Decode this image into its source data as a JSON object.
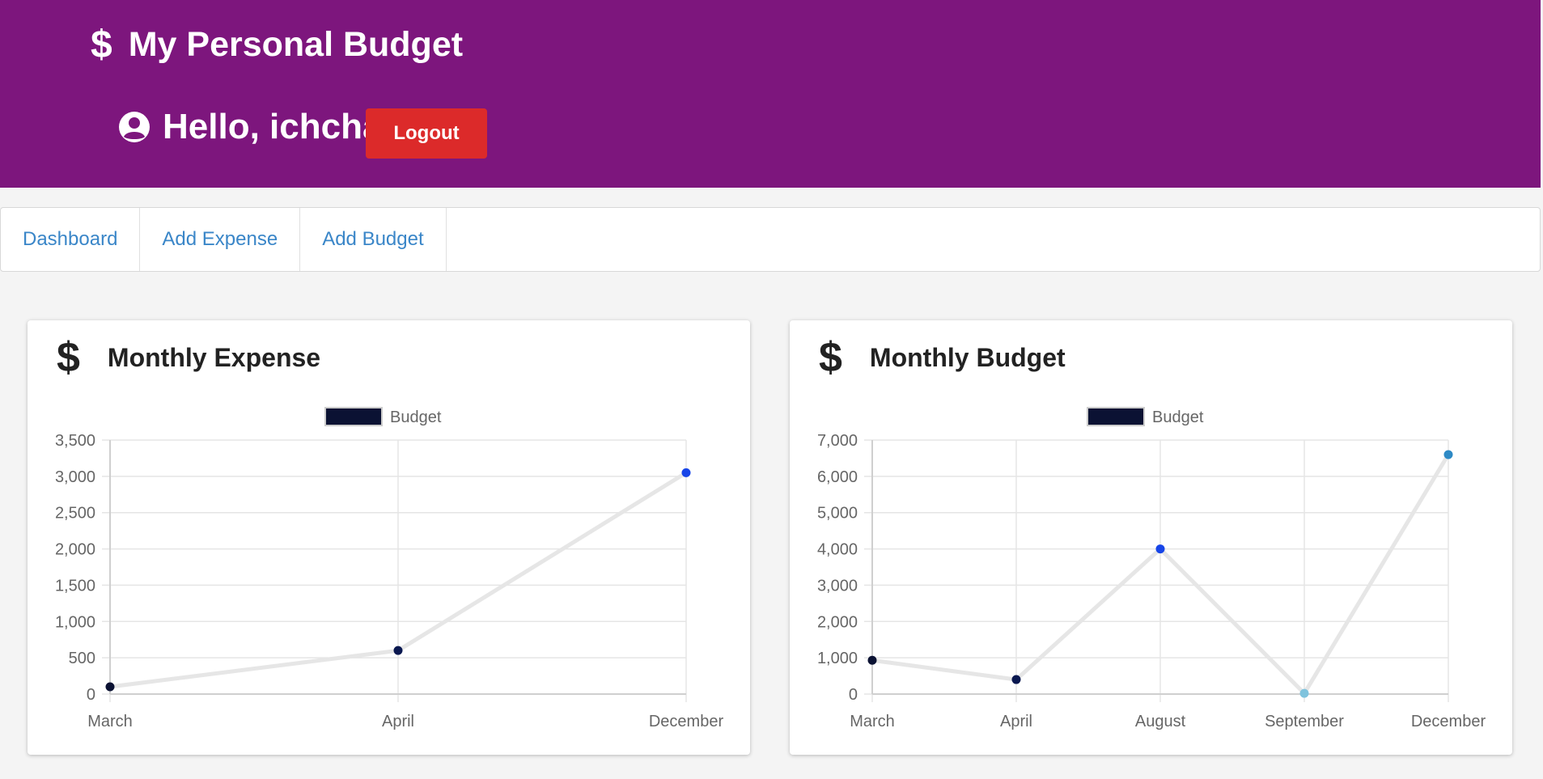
{
  "header": {
    "brand_icon": "$",
    "brand_title": "My Personal Budget",
    "greeting": "Hello, ichcha!",
    "logout_label": "Logout",
    "background_color": "#7d167d",
    "logout_color": "#dc2a2a"
  },
  "nav": {
    "items": [
      {
        "label": "Dashboard"
      },
      {
        "label": "Add Expense"
      },
      {
        "label": "Add Budget"
      }
    ]
  },
  "cards": {
    "expense": {
      "icon": "$",
      "title": "Monthly Expense"
    },
    "budget": {
      "icon": "$",
      "title": "Monthly Budget"
    }
  },
  "chart_data": [
    {
      "type": "line",
      "title": "",
      "legend": {
        "label": "Budget",
        "position": "top"
      },
      "categories": [
        "March",
        "April",
        "December"
      ],
      "series": [
        {
          "name": "Budget",
          "values": [
            100,
            600,
            3050
          ]
        }
      ],
      "point_colors": [
        "#0b1233",
        "#0a1850",
        "#1745e8"
      ],
      "line_color": "#e6e6e6",
      "ylim": [
        0,
        3500
      ],
      "yticks": [
        0,
        500,
        1000,
        1500,
        2000,
        2500,
        3000,
        3500
      ],
      "ytick_labels": [
        "0",
        "500",
        "1,000",
        "1,500",
        "2,000",
        "2,500",
        "3,000",
        "3,500"
      ],
      "grid": true
    },
    {
      "type": "line",
      "title": "",
      "legend": {
        "label": "Budget",
        "position": "top"
      },
      "categories": [
        "March",
        "April",
        "August",
        "September",
        "December"
      ],
      "series": [
        {
          "name": "Budget",
          "values": [
            930,
            400,
            4000,
            20,
            6600
          ]
        }
      ],
      "point_colors": [
        "#0b1233",
        "#0a1850",
        "#1745e8",
        "#7fc3dd",
        "#2e8ac5"
      ],
      "line_color": "#e6e6e6",
      "ylim": [
        0,
        7000
      ],
      "yticks": [
        0,
        1000,
        2000,
        3000,
        4000,
        5000,
        6000,
        7000
      ],
      "ytick_labels": [
        "0",
        "1,000",
        "2,000",
        "3,000",
        "4,000",
        "5,000",
        "6,000",
        "7,000"
      ],
      "grid": true
    }
  ]
}
